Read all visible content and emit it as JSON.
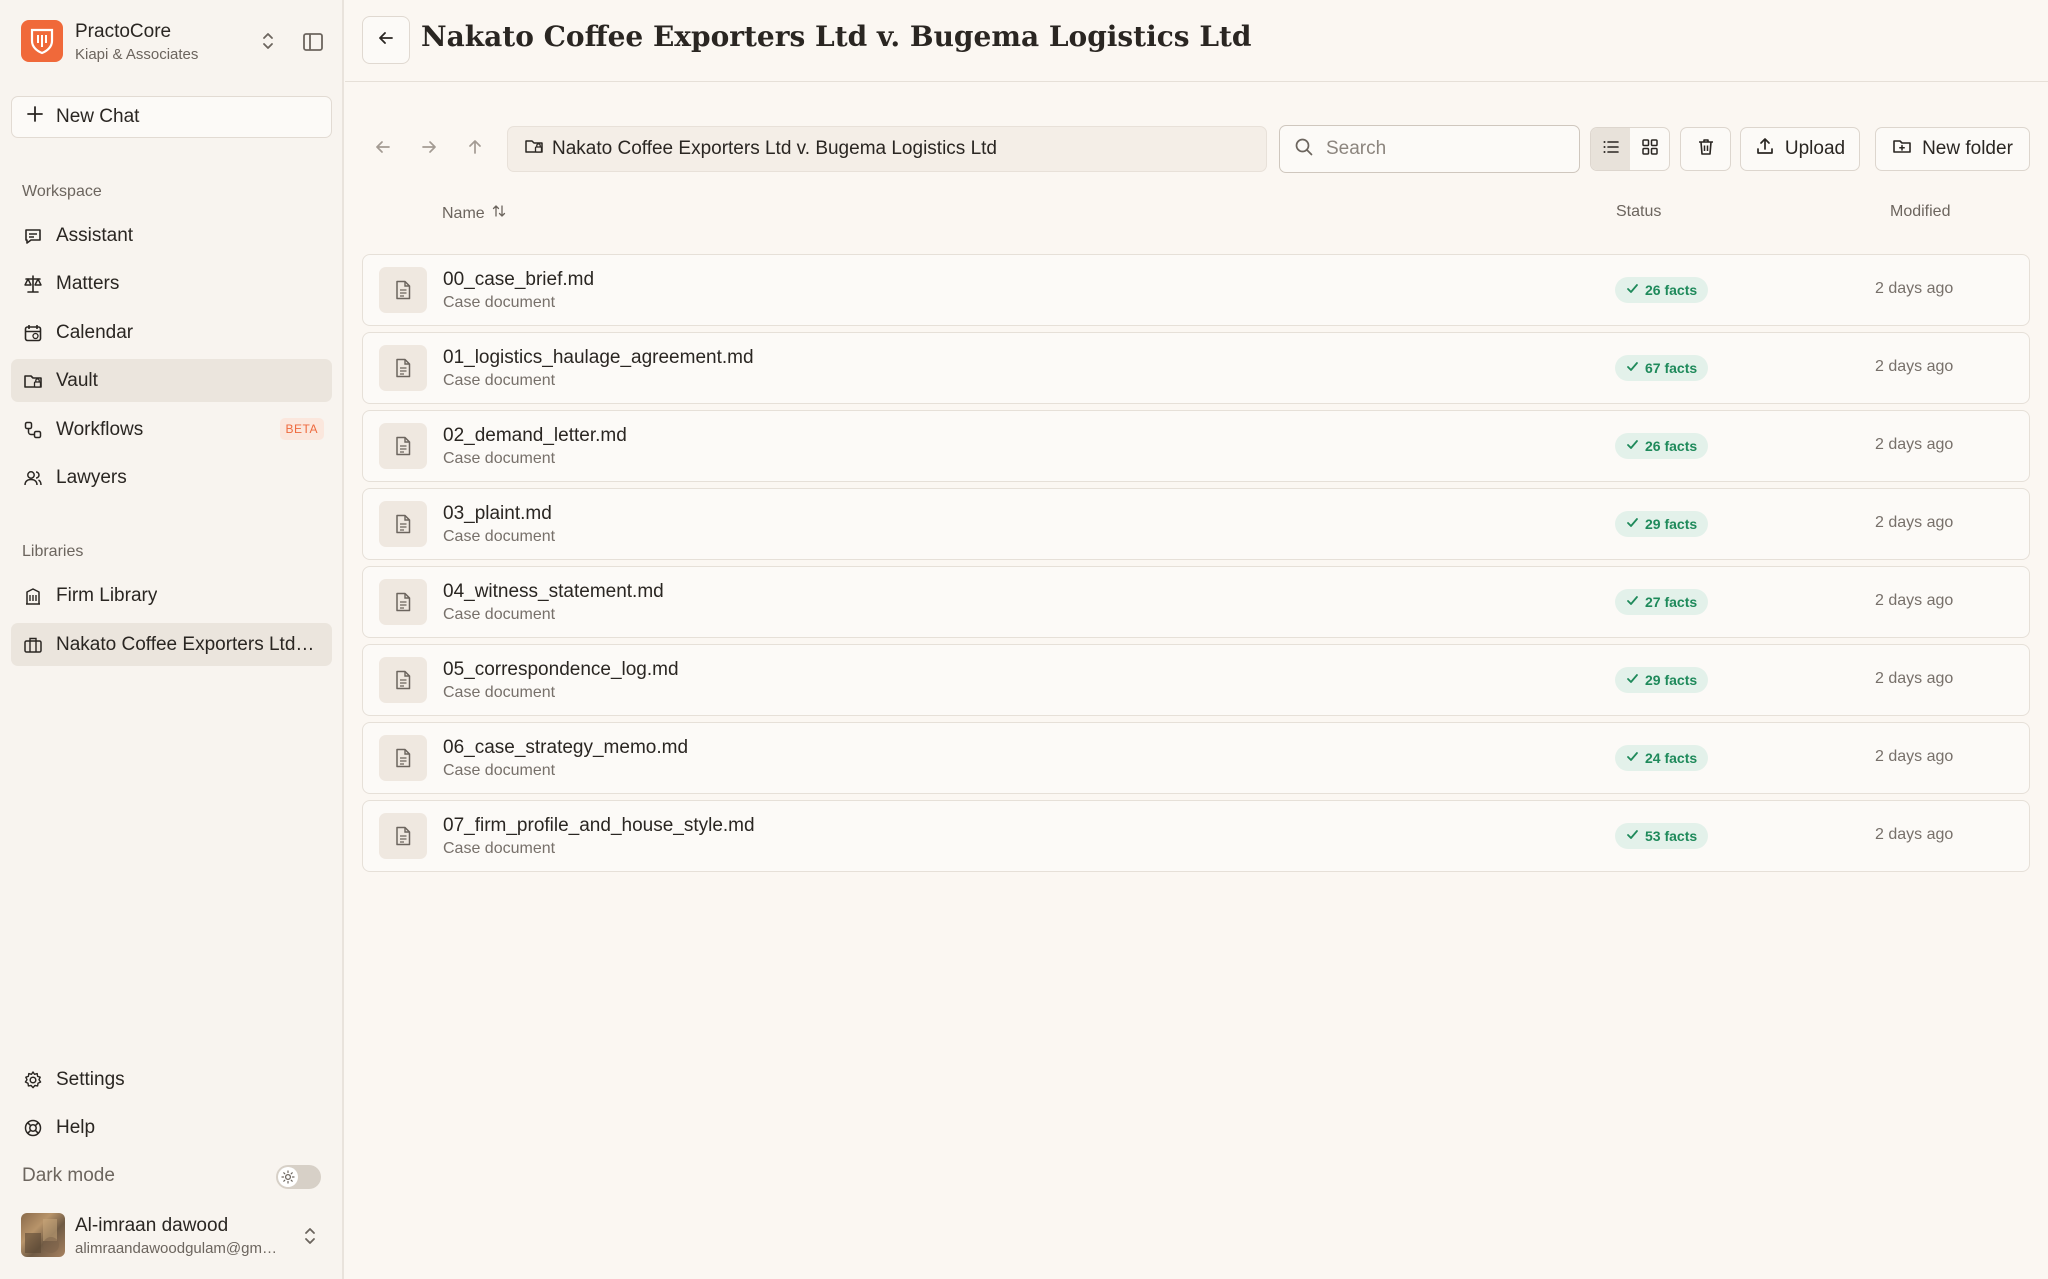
{
  "brand": {
    "name": "PractoCore",
    "org": "Kiapi & Associates"
  },
  "sidebar": {
    "new_chat": "New Chat",
    "workspace_label": "Workspace",
    "workspace": [
      {
        "label": "Assistant",
        "icon": "chat-icon"
      },
      {
        "label": "Matters",
        "icon": "scales-icon"
      },
      {
        "label": "Calendar",
        "icon": "calendar-icon"
      },
      {
        "label": "Vault",
        "icon": "folder-lock-icon",
        "active": true
      },
      {
        "label": "Workflows",
        "icon": "workflow-icon",
        "badge": "BETA"
      },
      {
        "label": "Lawyers",
        "icon": "users-icon"
      }
    ],
    "libraries_label": "Libraries",
    "libraries": [
      {
        "label": "Firm Library",
        "icon": "library-icon"
      },
      {
        "label": "Nakato Coffee Exporters Ltd v. Bugema Logistics Ltd",
        "icon": "briefcase-icon",
        "active": true
      }
    ],
    "settings": "Settings",
    "help": "Help",
    "dark_mode": "Dark mode",
    "dark_mode_on": false
  },
  "user": {
    "name": "Al-imraan dawood",
    "email": "alimraandawoodgulam@gmail.com"
  },
  "header": {
    "title": "Nakato Coffee Exporters Ltd v. Bugema Logistics Ltd"
  },
  "toolbar": {
    "path": "Nakato Coffee Exporters Ltd v. Bugema Logistics Ltd",
    "search_placeholder": "Search",
    "upload": "Upload",
    "new_folder": "New folder"
  },
  "columns": {
    "name": "Name",
    "status": "Status",
    "modified": "Modified"
  },
  "files": [
    {
      "name": "00_case_brief.md",
      "type": "Case document",
      "status": "26 facts",
      "modified": "2 days ago"
    },
    {
      "name": "01_logistics_haulage_agreement.md",
      "type": "Case document",
      "status": "67 facts",
      "modified": "2 days ago"
    },
    {
      "name": "02_demand_letter.md",
      "type": "Case document",
      "status": "26 facts",
      "modified": "2 days ago"
    },
    {
      "name": "03_plaint.md",
      "type": "Case document",
      "status": "29 facts",
      "modified": "2 days ago"
    },
    {
      "name": "04_witness_statement.md",
      "type": "Case document",
      "status": "27 facts",
      "modified": "2 days ago"
    },
    {
      "name": "05_correspondence_log.md",
      "type": "Case document",
      "status": "29 facts",
      "modified": "2 days ago"
    },
    {
      "name": "06_case_strategy_memo.md",
      "type": "Case document",
      "status": "24 facts",
      "modified": "2 days ago"
    },
    {
      "name": "07_firm_profile_and_house_style.md",
      "type": "Case document",
      "status": "53 facts",
      "modified": "2 days ago"
    }
  ],
  "colors": {
    "accent": "#f0693a",
    "success": "#1f8a5b",
    "success_bg": "#e3f1ea",
    "background": "#fbf7f2"
  }
}
